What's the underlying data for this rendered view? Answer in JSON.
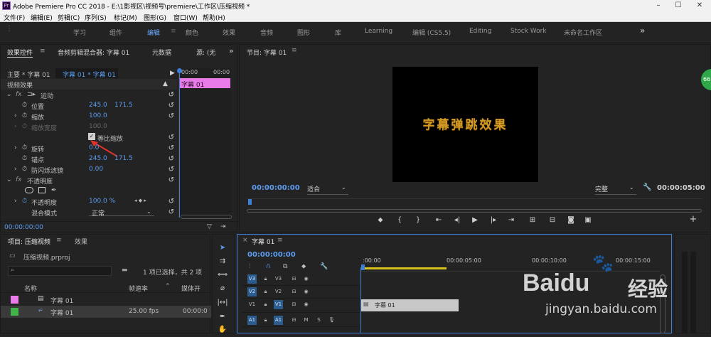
{
  "titlebar": {
    "logo": "Pr",
    "title": "Adobe Premiere Pro CC 2018 - E:\\1影视区\\视频号\\premiere\\工作区\\压缩视频 *"
  },
  "menu": [
    "文件(F)",
    "编辑(E)",
    "剪辑(C)",
    "序列(S)",
    "标记(M)",
    "图形(G)",
    "窗口(W)",
    "帮助(H)"
  ],
  "workspaces": [
    "学习",
    "组件",
    "编辑",
    "颜色",
    "效果",
    "音频",
    "图形",
    "库",
    "Learning",
    "编辑 (CS5.5)",
    "Editing",
    "Stock Work",
    "未命名工作区"
  ],
  "workspace_active": "编辑",
  "workspace_more": "»",
  "effect_controls": {
    "tabs": [
      "效果控件",
      "音频剪辑混合器: 字幕 01",
      "元数据",
      "源: (无"
    ],
    "more": "»",
    "master": "主要 * 字幕 01",
    "clip": "字幕 01 * 字幕 01",
    "ruler_start": "00:00",
    "ruler_end": "00:00",
    "clip_label": "字幕 01",
    "video_effects": "视频效果",
    "motion": "运动",
    "position_label": "位置",
    "position_x": "245.0",
    "position_y": "171.5",
    "scale_label": "缩放",
    "scale_value": "100.0",
    "scale_width_label": "缩放宽度",
    "scale_width_value": "100.0",
    "uniform_scale": "等比缩放",
    "rotation_label": "旋转",
    "rotation_value": "0.0",
    "anchor_label": "锚点",
    "anchor_x": "245.0",
    "anchor_y": "171.5",
    "flicker_label": "防闪烁滤镜",
    "flicker_value": "0.00",
    "opacity_section": "不透明度",
    "opacity_label": "不透明度",
    "opacity_value": "100.0 %",
    "blend_label": "混合模式",
    "blend_value": "正常",
    "timecode": "00:00:00:00"
  },
  "program": {
    "title": "节目: 字幕 01",
    "video_text": "字幕弹跳效果",
    "timecode": "00:00:00:00",
    "fit": "适合",
    "quality": "完整",
    "duration": "00:00:05:00"
  },
  "project": {
    "tabs": [
      "项目: 压缩视频",
      "效果"
    ],
    "file": "压缩视频.prproj",
    "status": "1 项已选择，共 2 项",
    "columns": [
      "名称",
      "帧速率",
      "媒体开"
    ],
    "rows": [
      {
        "name": "字幕 01",
        "fps": "",
        "media": "",
        "color": "#e87be8"
      },
      {
        "name": "字幕 01",
        "fps": "25.00 fps",
        "media": "00:00:0",
        "color": "#3fb54a"
      }
    ]
  },
  "timeline": {
    "tab": "字幕 01",
    "timecode": "00:00:00:00",
    "ruler": [
      ":00:00",
      "00:00:05:00",
      "00:00:10:00",
      "00:00:15:00"
    ],
    "tracks": [
      "V3",
      "V2",
      "V1",
      "A1"
    ],
    "clip_label": "字幕 01"
  },
  "watermark": {
    "brand": "Baidu",
    "sub": "经验",
    "url": "jingyan.baidu.com"
  },
  "badge": "66",
  "colors": {
    "accent": "#5b9cf0",
    "title_clip": "#e87be8",
    "video_clip": "#3fb54a",
    "playhead": "#3d7fd9"
  }
}
